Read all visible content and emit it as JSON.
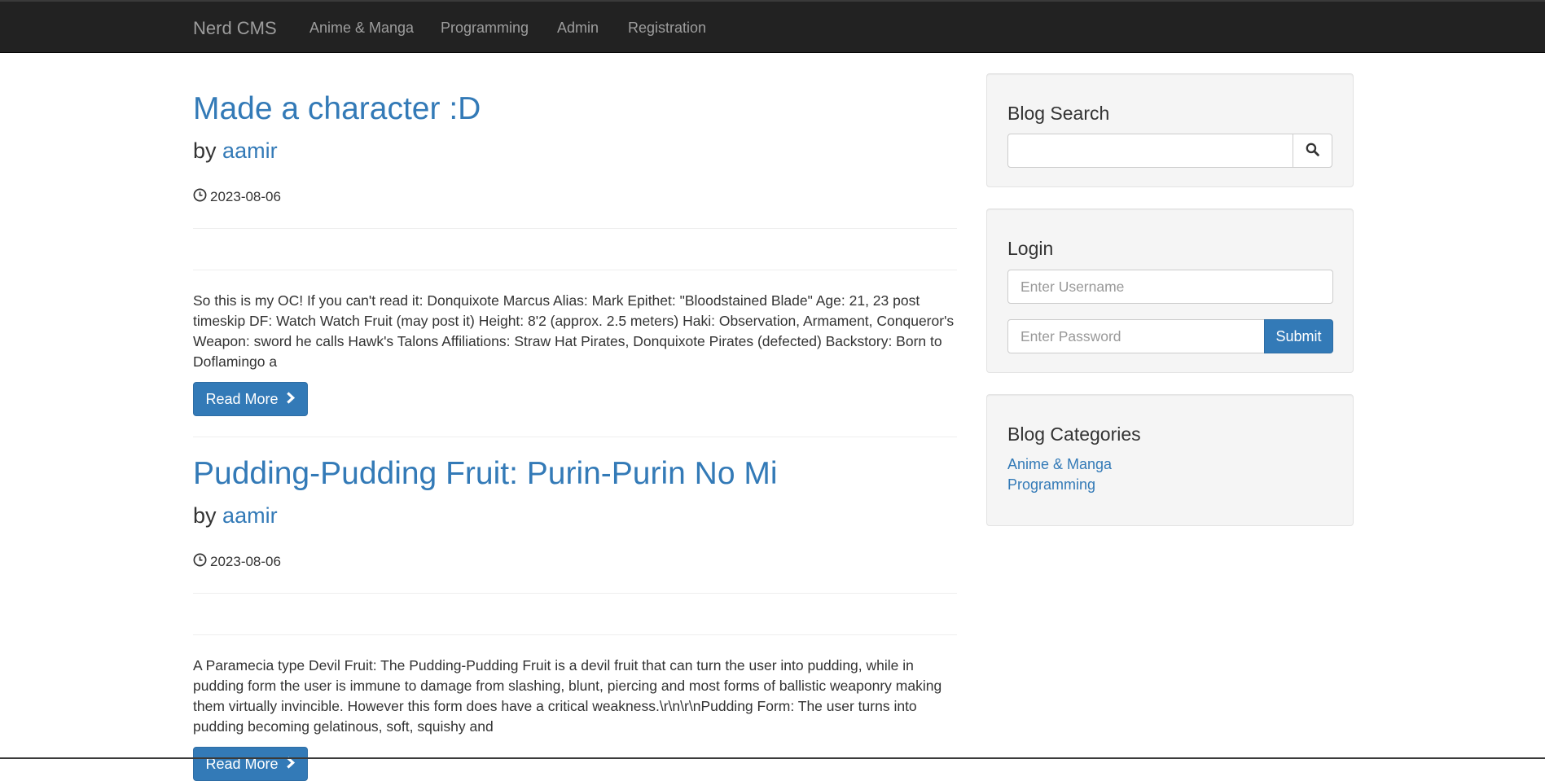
{
  "navbar": {
    "brand": "Nerd CMS",
    "links": [
      "Anime & Manga",
      "Programming",
      "Admin",
      "Registration"
    ]
  },
  "posts": [
    {
      "title": "Made a character :D",
      "by": "by",
      "author": "aamir",
      "date": "2023-08-06",
      "excerpt": "So this is my OC! If you can't read it: Donquixote Marcus Alias: Mark Epithet: \"Bloodstained Blade\" Age: 21, 23 post timeskip DF: Watch Watch Fruit (may post it) Height: 8'2 (approx. 2.5 meters) Haki: Observation, Armament, Conqueror's Weapon: sword he calls Hawk's Talons Affiliations: Straw Hat Pirates, Donquixote Pirates (defected) Backstory: Born to Doflamingo a",
      "read_more": "Read More"
    },
    {
      "title": "Pudding-Pudding Fruit: Purin-Purin No Mi",
      "by": "by",
      "author": "aamir",
      "date": "2023-08-06",
      "excerpt": "A Paramecia type Devil Fruit: The Pudding-Pudding Fruit is a devil fruit that can turn the user into pudding, while in pudding form the user is immune to damage from slashing, blunt, piercing and most forms of ballistic weaponry making them virtually invincible. However this form does have a critical weakness.\\r\\n\\r\\nPudding Form: The user turns into pudding becoming gelatinous, soft, squishy and",
      "read_more": "Read More"
    }
  ],
  "sidebar": {
    "search": {
      "title": "Blog Search",
      "value": ""
    },
    "login": {
      "title": "Login",
      "username_placeholder": "Enter Username",
      "password_placeholder": "Enter Password",
      "submit": "Submit"
    },
    "categories": {
      "title": "Blog Categories",
      "items": [
        "Anime & Manga",
        "Programming"
      ]
    }
  },
  "colors": {
    "navbar": "#222222",
    "link": "#337ab7",
    "primary": "#337ab7",
    "well": "#f5f5f5"
  }
}
